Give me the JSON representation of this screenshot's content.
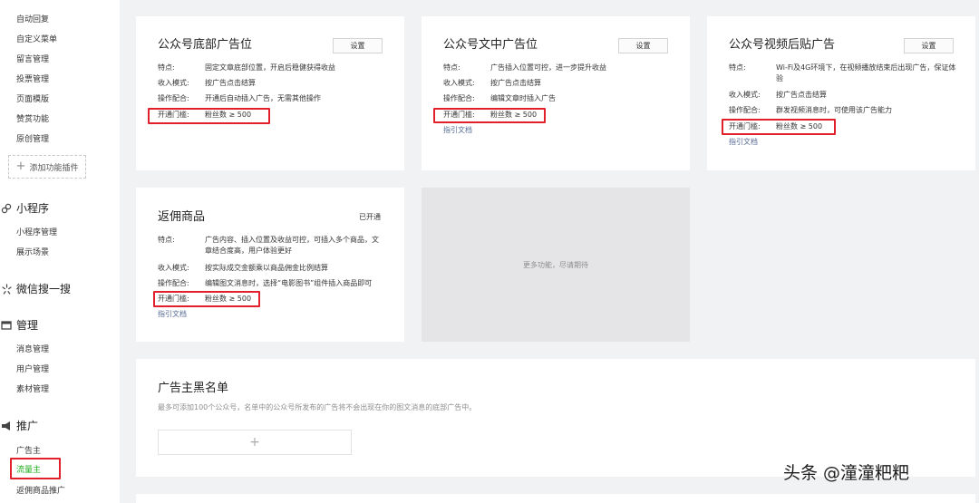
{
  "sidebar": {
    "top_items": [
      {
        "label": "自动回复"
      },
      {
        "label": "自定义菜单"
      },
      {
        "label": "留言管理"
      },
      {
        "label": "投票管理"
      },
      {
        "label": "页面模版"
      },
      {
        "label": "赞赏功能"
      },
      {
        "label": "原创管理"
      }
    ],
    "add_plugin": "添加功能插件",
    "sections": {
      "miniprogram": {
        "title": "小程序",
        "items": [
          "小程序管理",
          "展示场景"
        ]
      },
      "search": {
        "title": "微信搜一搜"
      },
      "manage": {
        "title": "管理",
        "items": [
          "消息管理",
          "用户管理",
          "素材管理"
        ]
      },
      "promote": {
        "title": "推广",
        "items": [
          "广告主",
          "流量主",
          "返佣商品推广"
        ]
      }
    }
  },
  "cards": {
    "bottom_ad": {
      "title": "公众号底部广告位",
      "button": "设置",
      "rows": [
        {
          "k": "特点:",
          "v": "固定文章底部位置，开启后稳健获得收益"
        },
        {
          "k": "收入模式:",
          "v": "按广告点击结算"
        },
        {
          "k": "操作配合:",
          "v": "开通后自动插入广告，无需其他操作"
        },
        {
          "k": "开通门槛:",
          "v": "粉丝数 ≥ 500"
        }
      ]
    },
    "middle_ad": {
      "title": "公众号文中广告位",
      "button": "设置",
      "rows": [
        {
          "k": "特点:",
          "v": "广告插入位置可控，进一步提升收益"
        },
        {
          "k": "收入模式:",
          "v": "按广告点击结算"
        },
        {
          "k": "操作配合:",
          "v": "编辑文章时插入广告"
        },
        {
          "k": "开通门槛:",
          "v": "粉丝数 ≥ 500"
        }
      ],
      "link": "指引文档"
    },
    "video_ad": {
      "title": "公众号视频后贴广告",
      "button": "设置",
      "rows": [
        {
          "k": "特点:",
          "v": "Wi-Fi及4G环境下，在视频播放结束后出现广告，保证体验"
        },
        {
          "k": "收入模式:",
          "v": "按广告点击结算"
        },
        {
          "k": "操作配合:",
          "v": "群发视频消息时，可使用该广告能力"
        },
        {
          "k": "开通门槛:",
          "v": "粉丝数 ≥ 500"
        }
      ],
      "link": "指引文档"
    },
    "rebate": {
      "title": "返佣商品",
      "status": "已开通",
      "rows": [
        {
          "k": "特点:",
          "v": "广告内容、插入位置及收益可控，可插入多个商品，文章结合度高，用户体验更好"
        },
        {
          "k": "收入模式:",
          "v": "按实际成交金额乘以商品佣金比例结算"
        },
        {
          "k": "操作配合:",
          "v": "编辑图文消息时，选择“电影图书”组件插入商品即可"
        },
        {
          "k": "开通门槛:",
          "v": "粉丝数 ≥ 500"
        }
      ],
      "link": "指引文档"
    }
  },
  "more": "更多功能，尽请期待",
  "blacklist": {
    "title": "广告主黑名单",
    "desc": "最多可添加100个公众号，名单中的公众号所发布的广告将不会出现在你的图文消息的底部广告中。",
    "add": "+"
  },
  "watermark": "头条 @潼潼粑粑"
}
